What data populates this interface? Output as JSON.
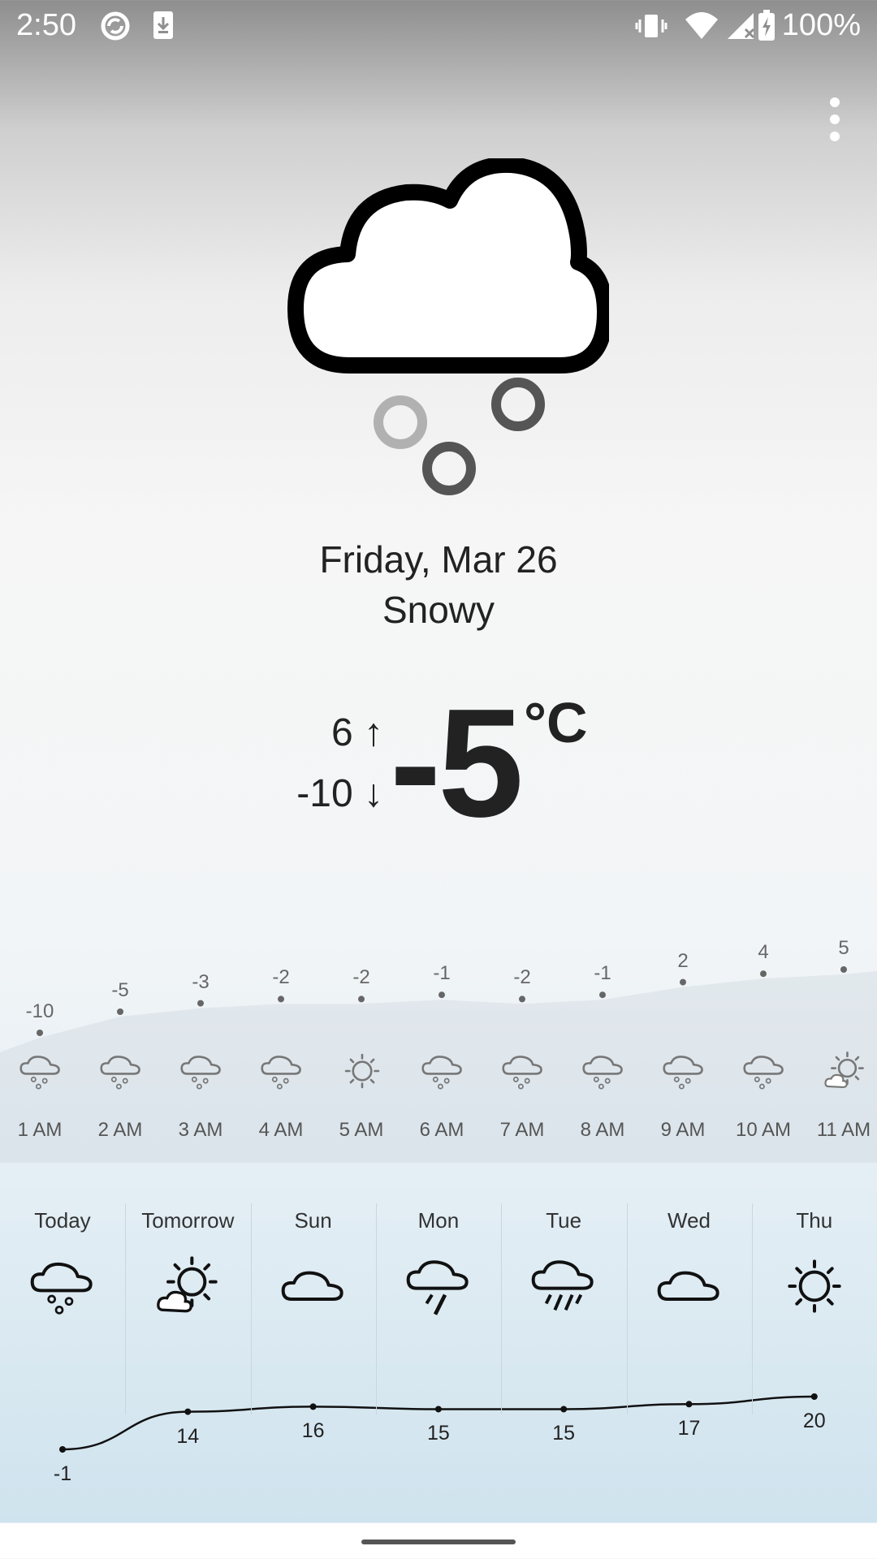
{
  "status_bar": {
    "time": "2:50",
    "battery": "100%",
    "icons": [
      "do-not-disturb-icon",
      "download-icon",
      "vibrate-icon",
      "wifi-icon",
      "signal-icon",
      "battery-charging-icon"
    ]
  },
  "current": {
    "date": "Friday, Mar 26",
    "condition": "Snowy",
    "high": "6 ↑",
    "low": "-10 ↓",
    "temperature": "-5",
    "unit": "°C",
    "icon": "snow-cloud-icon"
  },
  "hourly": [
    {
      "time": "1 AM",
      "temp": "-10",
      "icon": "snow-icon"
    },
    {
      "time": "2 AM",
      "temp": "-5",
      "icon": "snow-icon"
    },
    {
      "time": "3 AM",
      "temp": "-3",
      "icon": "snow-icon"
    },
    {
      "time": "4 AM",
      "temp": "-2",
      "icon": "snow-icon"
    },
    {
      "time": "5 AM",
      "temp": "-2",
      "icon": "sun-icon"
    },
    {
      "time": "6 AM",
      "temp": "-1",
      "icon": "snow-icon"
    },
    {
      "time": "7 AM",
      "temp": "-2",
      "icon": "snow-icon"
    },
    {
      "time": "8 AM",
      "temp": "-1",
      "icon": "snow-icon"
    },
    {
      "time": "9 AM",
      "temp": "2",
      "icon": "snow-icon"
    },
    {
      "time": "10 AM",
      "temp": "4",
      "icon": "snow-icon"
    },
    {
      "time": "11 AM",
      "temp": "5",
      "icon": "partly-cloudy-icon"
    }
  ],
  "daily": [
    {
      "day": "Today",
      "temp": "-1",
      "icon": "snow-icon"
    },
    {
      "day": "Tomorrow",
      "temp": "14",
      "icon": "partly-cloudy-icon"
    },
    {
      "day": "Sun",
      "temp": "16",
      "icon": "cloud-icon"
    },
    {
      "day": "Mon",
      "temp": "15",
      "icon": "thunderstorm-icon"
    },
    {
      "day": "Tue",
      "temp": "15",
      "icon": "rain-icon"
    },
    {
      "day": "Wed",
      "temp": "17",
      "icon": "cloud-icon"
    },
    {
      "day": "Thu",
      "temp": "20",
      "icon": "sun-icon"
    }
  ]
}
